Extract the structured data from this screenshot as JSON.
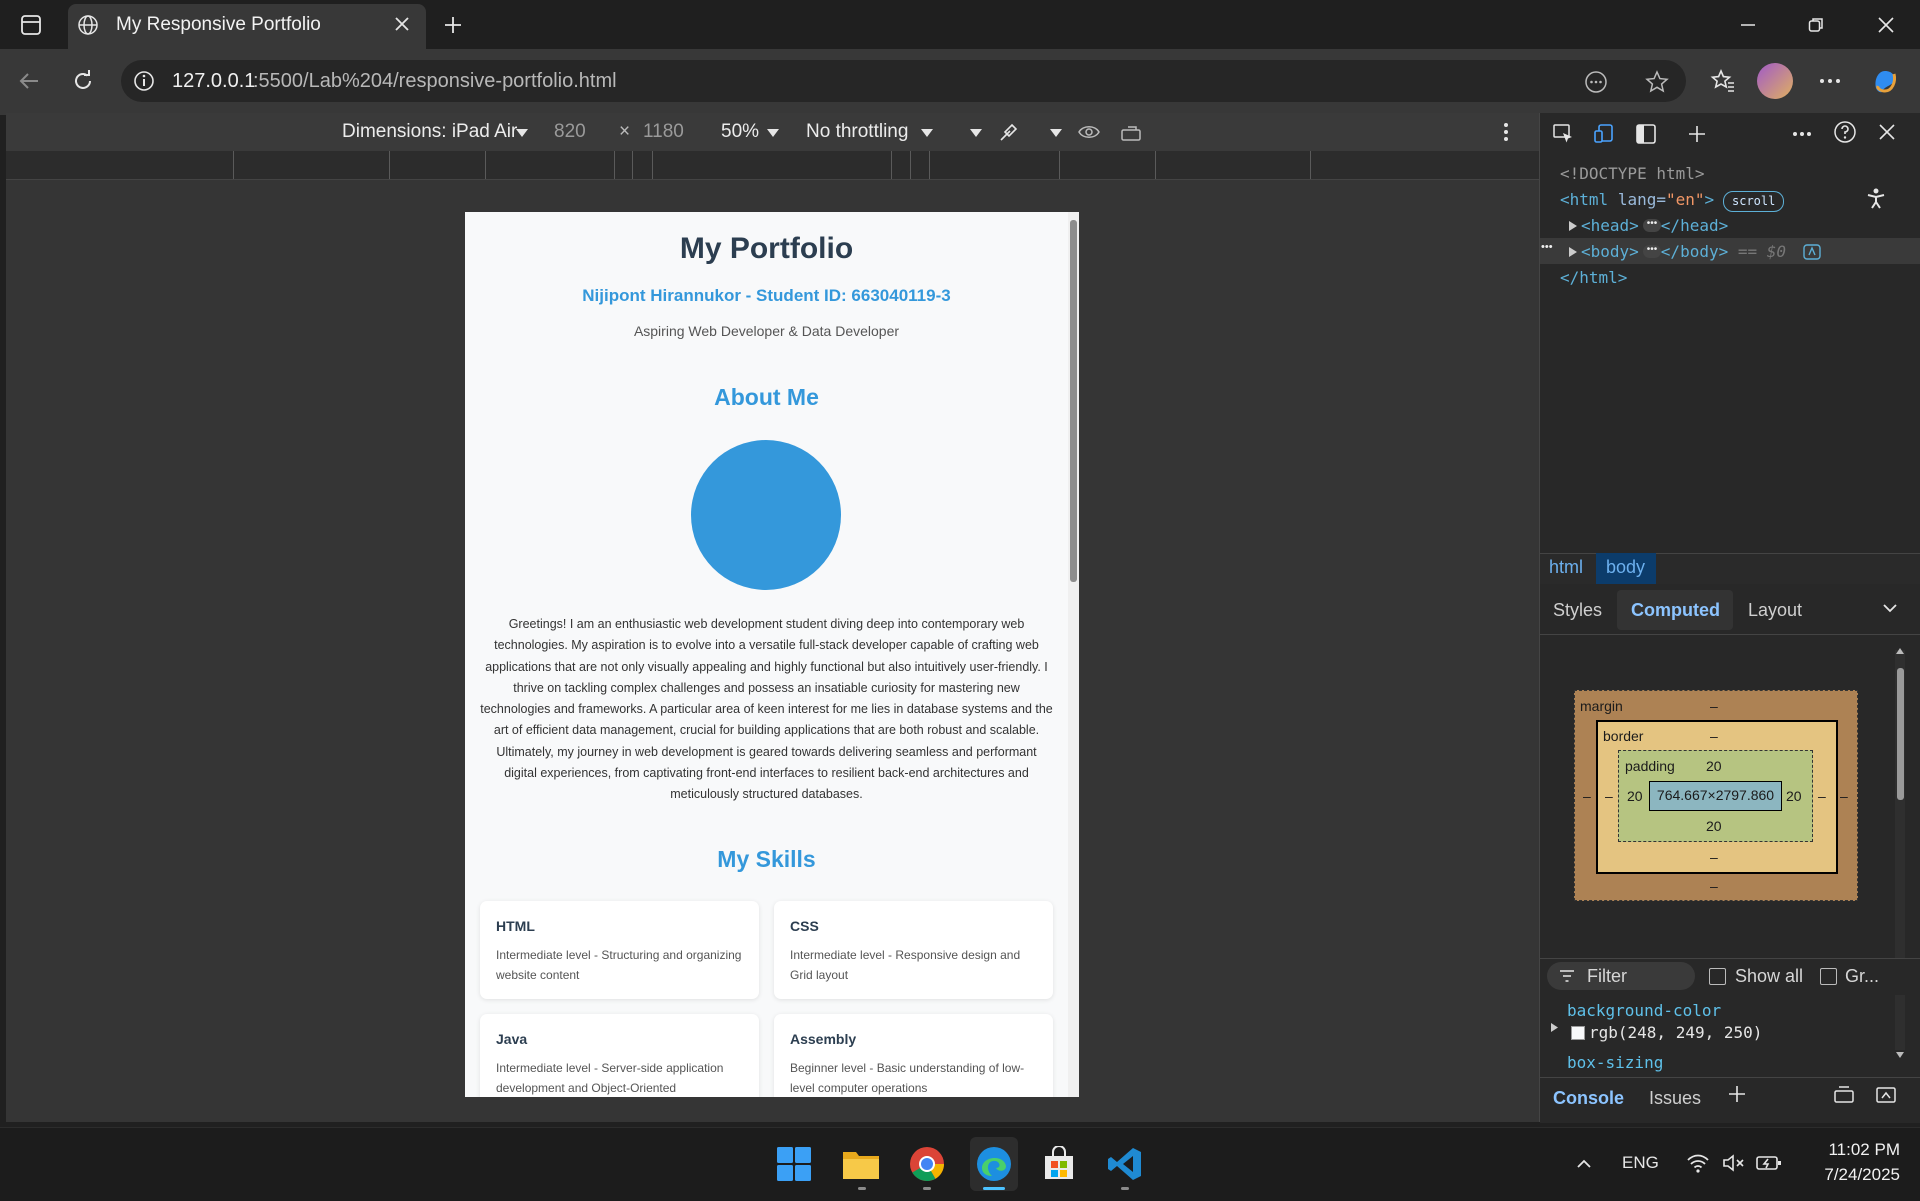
{
  "browser": {
    "tab_title": "My Responsive Portfolio",
    "url_host": "127.0.0.1",
    "url_path": ":5500/Lab%204/responsive-portfolio.html"
  },
  "emulation": {
    "device": "Dimensions: iPad Air",
    "width": "820",
    "height": "1180",
    "x_sep": "×",
    "zoom": "50%",
    "throttling": "No throttling"
  },
  "portfolio": {
    "title": "My Portfolio",
    "name_line": "Nijipont Hirannukor - Student ID: 663040119-3",
    "tagline": "Aspiring Web Developer & Data Developer",
    "about_heading": "About Me",
    "bio": "Greetings! I am an enthusiastic web development student diving deep into contemporary web technologies. My aspiration is to evolve into a versatile full-stack developer capable of crafting web applications that are not only visually appealing and highly functional but also intuitively user-friendly. I thrive on tackling complex challenges and possess an insatiable curiosity for mastering new technologies and frameworks. A particular area of keen interest for me lies in database systems and the art of efficient data management, crucial for building applications that are both robust and scalable. Ultimately, my journey in web development is geared towards delivering seamless and performant digital experiences, from captivating front-end interfaces to resilient back-end architectures and meticulously structured databases.",
    "skills_heading": "My Skills",
    "skills": [
      {
        "name": "HTML",
        "desc": "Intermediate level - Structuring and organizing website content"
      },
      {
        "name": "CSS",
        "desc": "Intermediate level - Responsive design and Grid layout"
      },
      {
        "name": "Java",
        "desc": "Intermediate level - Server-side application development and Object-Oriented"
      },
      {
        "name": "Assembly",
        "desc": "Beginner level - Basic understanding of low-level computer operations"
      }
    ]
  },
  "devtools": {
    "doctype": "<!DOCTYPE html>",
    "html_open_tag": "<html",
    "lang_attr": "lang",
    "lang_value": "\"en\"",
    "scroll_badge": "scroll",
    "head_open": "<head>",
    "head_close": "</head>",
    "body_open": "<body>",
    "body_close": "</body>",
    "eq_ref": "== $0",
    "html_close": "</html>",
    "breadcrumb_html": "html",
    "breadcrumb_body": "body",
    "tabs": {
      "styles": "Styles",
      "computed": "Computed",
      "layout": "Layout"
    },
    "box_model": {
      "margin_label": "margin",
      "border_label": "border",
      "padding_label": "padding",
      "dash": "–",
      "padding_value": "20",
      "content_size": "764.667×2797.860"
    },
    "filter_placeholder": "Filter",
    "show_all": "Show all",
    "group": "Gr...",
    "props": [
      {
        "name": "background-color",
        "value": "rgb(248, 249, 250)"
      },
      {
        "name": "box-sizing",
        "value": ""
      }
    ],
    "drawer": {
      "console": "Console",
      "issues": "Issues"
    }
  },
  "taskbar": {
    "lang": "ENG",
    "time": "11:02 PM",
    "date": "7/24/2025"
  },
  "colors": {
    "accent": "#3498db",
    "heading": "#2c3e50",
    "page_bg": "#f8f9fa"
  }
}
